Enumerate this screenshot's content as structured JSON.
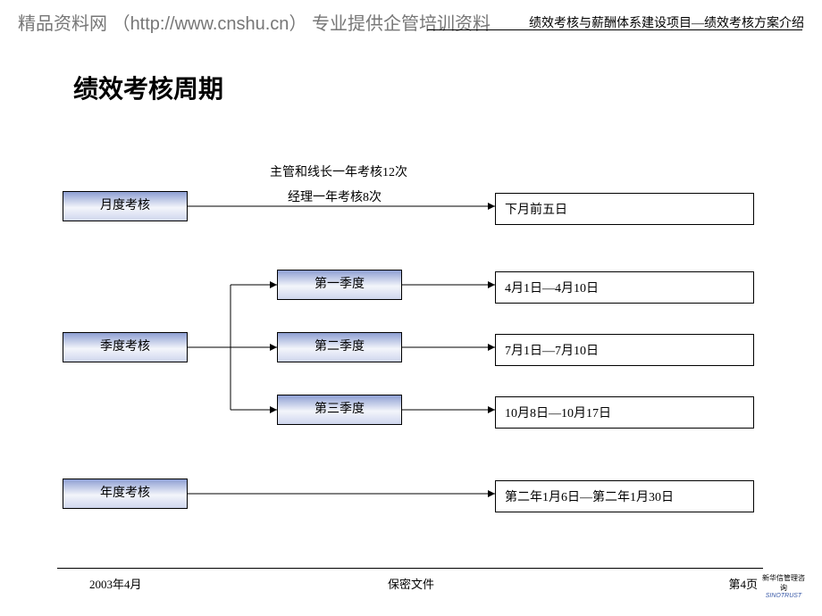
{
  "header": {
    "site_name": "精品资料网",
    "site_url_prefix": "（",
    "site_url": "http://www.cnshu.cn",
    "site_url_suffix": "）",
    "tagline": "专业提供企管培训资料",
    "doc_title": "绩效考核与薪酬体系建设项目—绩效考核方案介绍"
  },
  "title": "绩效考核周期",
  "notes": {
    "line1": "主管和线长一年考核12次",
    "line2": "经理一年考核8次"
  },
  "rows": {
    "monthly": {
      "label": "月度考核",
      "result": "下月前五日"
    },
    "quarterly": {
      "label": "季度考核",
      "q1": {
        "label": "第一季度",
        "result": "4月1日—4月10日"
      },
      "q2": {
        "label": "第二季度",
        "result": "7月1日—7月10日"
      },
      "q3": {
        "label": "第三季度",
        "result": "10月8日—10月17日"
      }
    },
    "yearly": {
      "label": "年度考核",
      "result": "第二年1月6日—第二年1月30日"
    }
  },
  "footer": {
    "date": "2003年4月",
    "confidential": "保密文件",
    "page": "第4页",
    "brand_cn": "新华信管理咨询",
    "brand_en": "SINOTRUST"
  }
}
